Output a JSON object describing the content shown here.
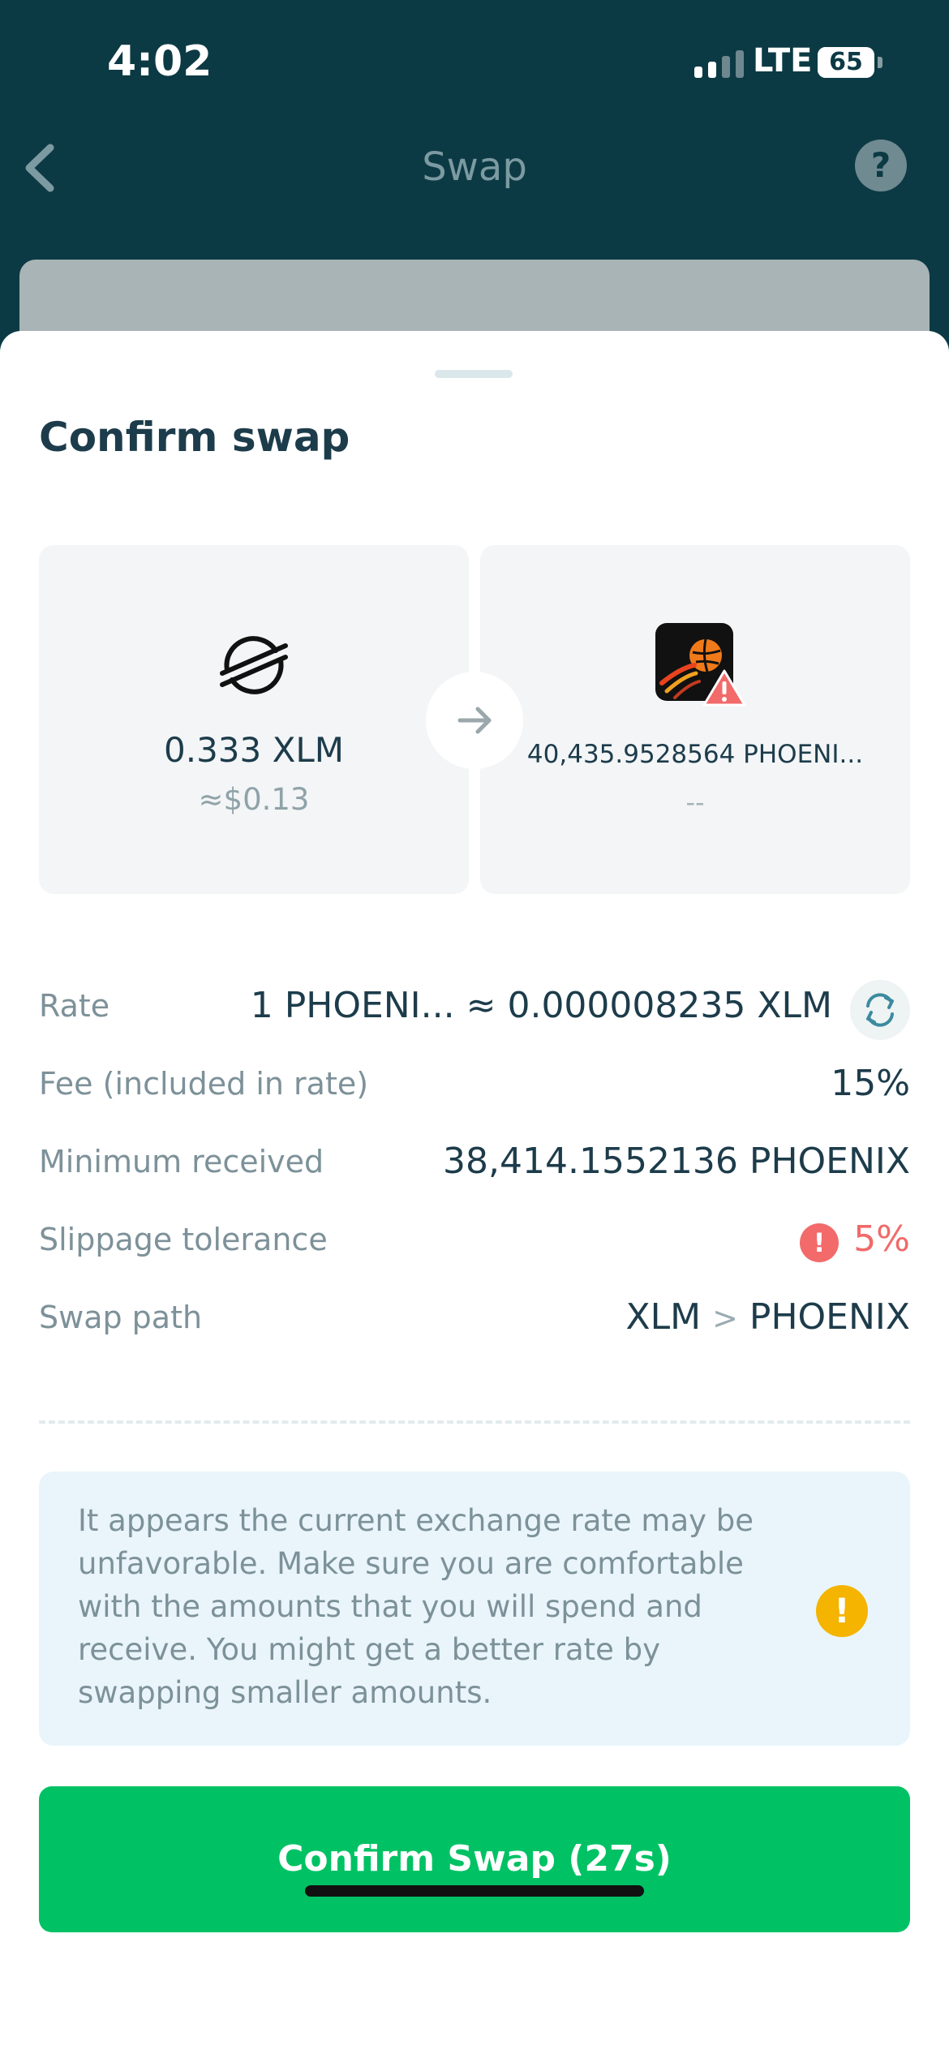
{
  "status_bar": {
    "time": "4:02",
    "network": "LTE",
    "battery": "65",
    "battery_level": 0.65
  },
  "nav": {
    "title": "Swap",
    "help": "?"
  },
  "sheet": {
    "title": "Confirm swap",
    "from": {
      "amount": "0.333 XLM",
      "fiat": "≈$0.13",
      "icon": "stellar-xlm-icon"
    },
    "to": {
      "amount": "40,435.9528564 PHOENI...",
      "fiat": "--",
      "icon": "phoenix-token-icon",
      "warning_icon": "warning-triangle-icon"
    },
    "details": {
      "rate_label": "Rate",
      "rate_value": "1 PHOENI... ≈ 0.000008235 XLM",
      "fee_label": "Fee (included in rate)",
      "fee_value": "15%",
      "min_label": "Minimum received",
      "min_value": "38,414.1552136 PHOENIX",
      "slippage_label": "Slippage tolerance",
      "slippage_value": "5%",
      "path_label": "Swap path",
      "path_from": "XLM",
      "path_sep": ">",
      "path_to": "PHOENIX"
    },
    "warning_text": "It appears the current exchange rate may be unfavorable. Make sure you are comfortable with the amounts that you will spend and receive. You might get a better rate by swapping smaller amounts.",
    "confirm_label": "Confirm Swap (27s)"
  },
  "colors": {
    "header_bg": "#0c3a44",
    "primary_text": "#1d3c4b",
    "muted_text": "#7d9199",
    "confirm_green": "#00c264",
    "danger": "#f06a6a",
    "warning": "#f4b400"
  }
}
